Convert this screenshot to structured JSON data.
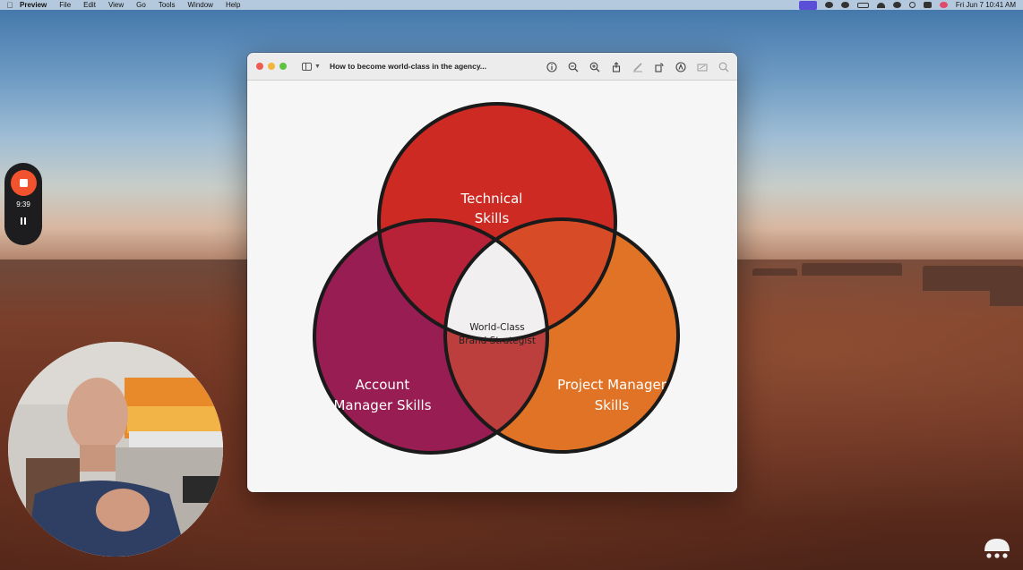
{
  "menubar": {
    "app": "Preview",
    "items": [
      "File",
      "Edit",
      "View",
      "Go",
      "Tools",
      "Window",
      "Help"
    ],
    "clock": "Fri Jun 7  10:41 AM"
  },
  "window": {
    "title": "How to become world-class in the agency..."
  },
  "recorder": {
    "timer": "9:39"
  },
  "venn": {
    "top_label": [
      "Technical",
      "Skills"
    ],
    "left_label": [
      "Account",
      "Manager Skills"
    ],
    "right_label": [
      "Project Manager",
      "Skills"
    ],
    "center_label": [
      "World-Class",
      "Brand Strategist"
    ],
    "colors": {
      "top": "#cd2a24",
      "left": "#981d52",
      "right": "#e07326",
      "top_left": "#b72238",
      "top_right": "#d74b26",
      "left_right": "#bd3f3d",
      "center": "#f1efef",
      "outline": "#1a1a1a"
    }
  }
}
